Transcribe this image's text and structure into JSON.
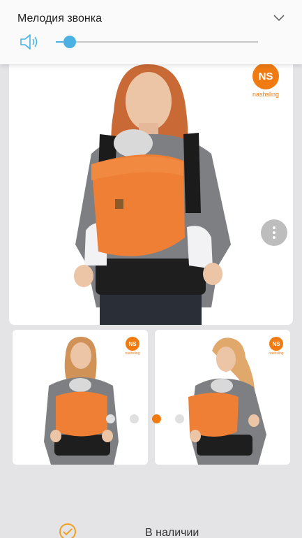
{
  "volume_panel": {
    "title": "Мелодия звонка",
    "level_percent": 7,
    "icons": {
      "speaker": "speaker-icon",
      "chevron": "chevron-down-icon"
    },
    "accent_color": "#4ab1e2"
  },
  "product": {
    "brand_logo": {
      "mark": "NS",
      "name": "nashsling",
      "color": "#f07b12"
    },
    "gallery": {
      "dot_count": 4,
      "active_dot_index": 2,
      "active_dot_color": "#f07b12"
    }
  },
  "availability": {
    "label": "В наличии",
    "icon": "check-circle-icon"
  }
}
